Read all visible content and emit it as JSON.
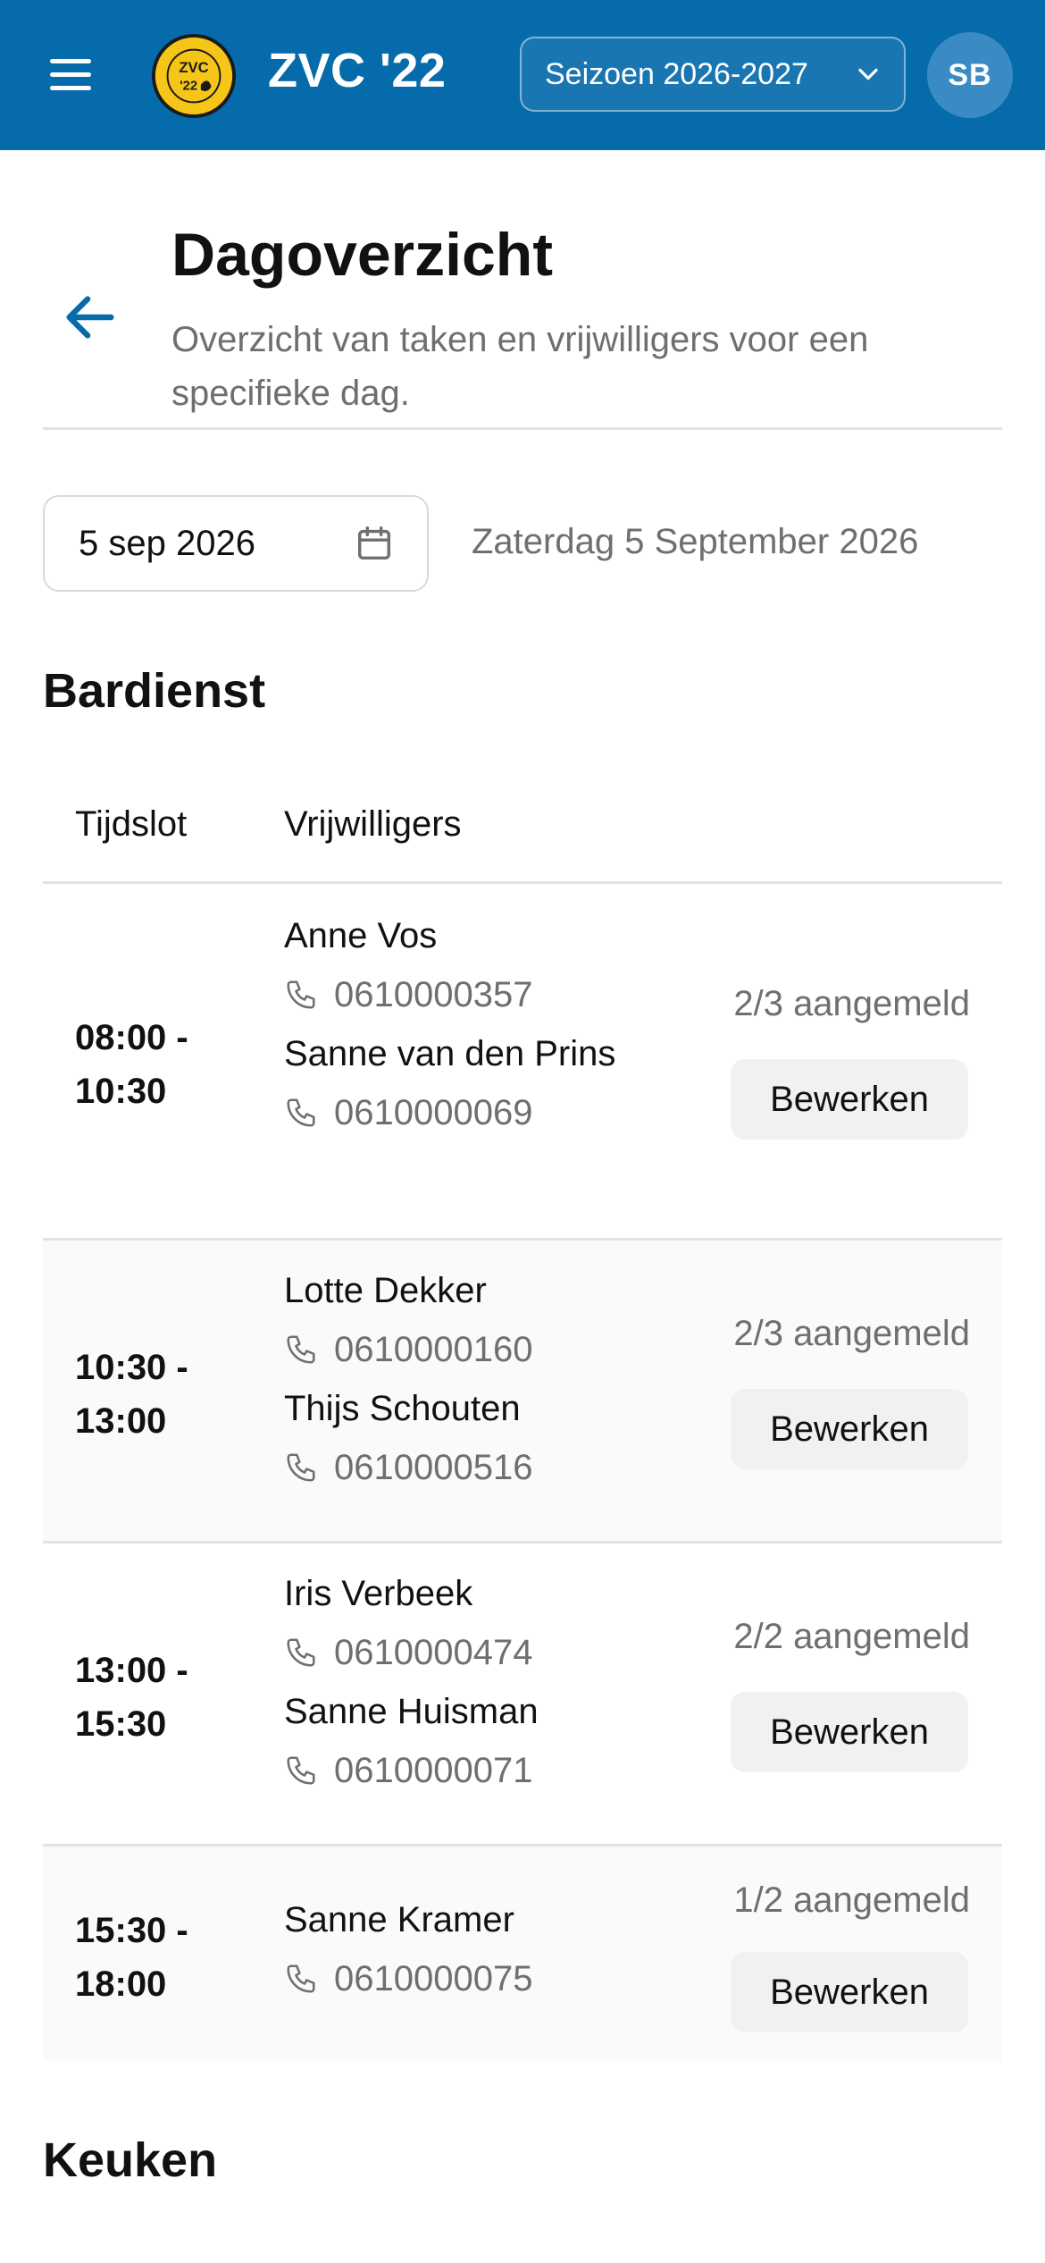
{
  "header": {
    "app_title": "ZVC '22",
    "season_selected": "Seizoen 2026-2027",
    "user_initials": "SB",
    "brand_color": "#066bab",
    "logo_text_top": "ZVC",
    "logo_text_bottom": "'22"
  },
  "page": {
    "title": "Dagoverzicht",
    "subtitle": "Overzicht van taken en vrijwilligers voor een specifieke dag."
  },
  "date": {
    "input_value": "5 sep 2026",
    "long_label": "Zaterdag 5 September 2026"
  },
  "sections": {
    "bardienst": {
      "title": "Bardienst",
      "col_timeslot": "Tijdslot",
      "col_volunteers": "Vrijwilligers",
      "rows": [
        {
          "time_start": "08:00 -",
          "time_end": "10:30",
          "volunteers": [
            {
              "name": "Anne Vos",
              "phone": "0610000357"
            },
            {
              "name": "Sanne van den Prins",
              "phone": "0610000069"
            }
          ],
          "count": "2/3 aangemeld",
          "edit_label": "Bewerken"
        },
        {
          "time_start": "10:30 -",
          "time_end": "13:00",
          "volunteers": [
            {
              "name": "Lotte Dekker",
              "phone": "0610000160"
            },
            {
              "name": "Thijs Schouten",
              "phone": "0610000516"
            }
          ],
          "count": "2/3 aangemeld",
          "edit_label": "Bewerken"
        },
        {
          "time_start": "13:00 -",
          "time_end": "15:30",
          "volunteers": [
            {
              "name": "Iris Verbeek",
              "phone": "0610000474"
            },
            {
              "name": "Sanne Huisman",
              "phone": "0610000071"
            }
          ],
          "count": "2/2 aangemeld",
          "edit_label": "Bewerken"
        },
        {
          "time_start": "15:30 -",
          "time_end": "18:00",
          "volunteers": [
            {
              "name": "Sanne Kramer",
              "phone": "0610000075"
            }
          ],
          "count": "1/2 aangemeld",
          "edit_label": "Bewerken"
        }
      ]
    },
    "keuken": {
      "title": "Keuken"
    }
  }
}
